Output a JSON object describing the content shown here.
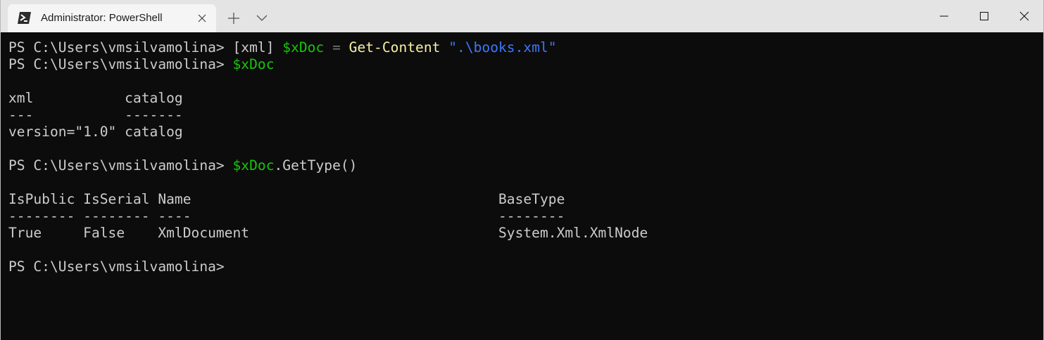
{
  "window": {
    "tab_title": "Administrator: PowerShell"
  },
  "icons": {
    "tab": "powershell-icon",
    "tab_close": "close-icon",
    "new_tab": "plus-icon",
    "dropdown": "chevron-down-icon",
    "minimize": "minimize-icon",
    "maximize": "maximize-icon",
    "close": "close-icon"
  },
  "colors": {
    "background": "#0c0c0c",
    "foreground": "#cccccc",
    "variable": "#16c60c",
    "command": "#f9f1a5",
    "string": "#3b78ff",
    "operator": "#767676",
    "titlebar": "#e4e4e4",
    "tab": "#f5f5f5"
  },
  "terminal": {
    "lines": [
      [
        {
          "t": "PS C:\\Users\\vmsilvamolina> ",
          "c": "def"
        },
        {
          "t": "[xml] ",
          "c": "def"
        },
        {
          "t": "$xDoc",
          "c": "var"
        },
        {
          "t": " = ",
          "c": "op"
        },
        {
          "t": "Get-Content",
          "c": "cmd"
        },
        {
          "t": " ",
          "c": "def"
        },
        {
          "t": "\".\\books.xml\"",
          "c": "str"
        }
      ],
      [
        {
          "t": "PS C:\\Users\\vmsilvamolina> ",
          "c": "def"
        },
        {
          "t": "$xDoc",
          "c": "var"
        }
      ],
      [],
      [
        {
          "t": "xml           catalog",
          "c": "def"
        }
      ],
      [
        {
          "t": "---           -------",
          "c": "def"
        }
      ],
      [
        {
          "t": "version=\"1.0\" catalog",
          "c": "def"
        }
      ],
      [],
      [
        {
          "t": "PS C:\\Users\\vmsilvamolina> ",
          "c": "def"
        },
        {
          "t": "$xDoc",
          "c": "var"
        },
        {
          "t": ".GetType()",
          "c": "def"
        }
      ],
      [],
      [
        {
          "t": "IsPublic IsSerial Name                                     BaseType",
          "c": "def"
        }
      ],
      [
        {
          "t": "-------- -------- ----                                     --------",
          "c": "def"
        }
      ],
      [
        {
          "t": "True     False    XmlDocument                              System.Xml.XmlNode",
          "c": "def"
        }
      ],
      [],
      [
        {
          "t": "PS C:\\Users\\vmsilvamolina> ",
          "c": "def"
        }
      ]
    ]
  }
}
